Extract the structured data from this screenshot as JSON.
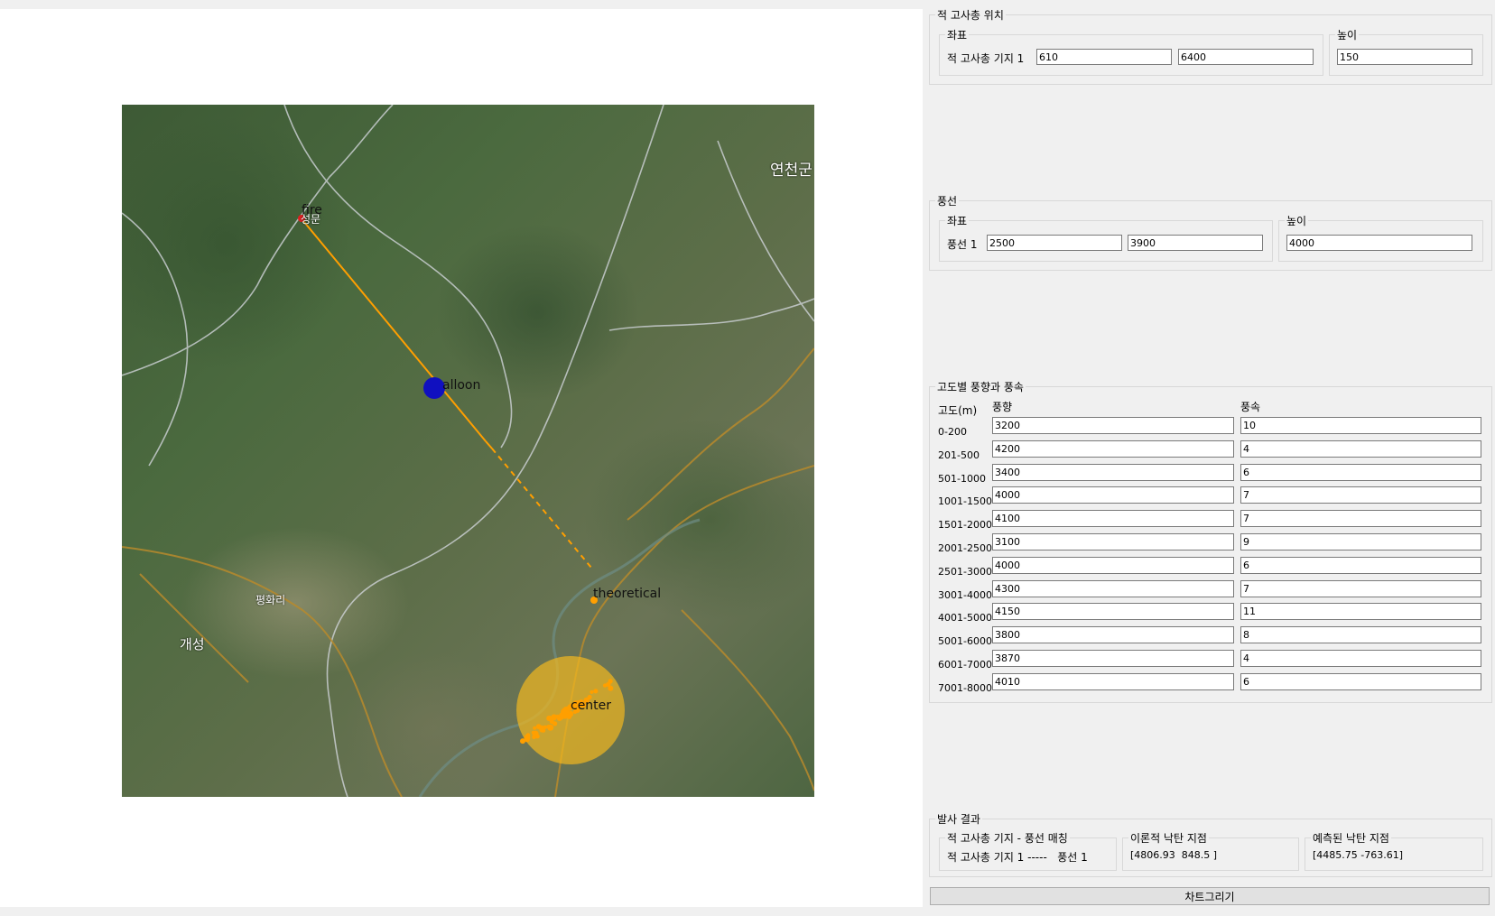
{
  "plot": {
    "labels": {
      "fire": "fire",
      "balloon": "alloon",
      "theoretical": "theoretical",
      "center": "center"
    },
    "places": {
      "yeoncheon": "연천군",
      "gaeseong": "개성",
      "pyeonghwa": "평화리",
      "near_fire": "성문"
    },
    "colors": {
      "trajectory": "#ff9f00",
      "balloon": "#1010c0",
      "fire": "#e02020",
      "impact_zone": "#f2b820",
      "scatter": "#ff9f00"
    }
  },
  "enemy_position": {
    "legend": "적 고사총 위치",
    "coords_legend": "좌표",
    "height_legend": "높이",
    "base_label": "적 고사총 기지 1",
    "x": "610",
    "y": "6400",
    "height": "150"
  },
  "balloon": {
    "legend": "풍선",
    "coords_legend": "좌표",
    "height_legend": "높이",
    "label": "풍선 1",
    "x": "2500",
    "y": "3900",
    "height": "4000"
  },
  "wind": {
    "legend": "고도별 풍향과 풍속",
    "col_altitude": "고도(m)",
    "col_direction": "풍향",
    "col_speed": "풍속",
    "rows": [
      {
        "altitude": "0-200",
        "direction": "3200",
        "speed": "10"
      },
      {
        "altitude": "201-500",
        "direction": "4200",
        "speed": "4"
      },
      {
        "altitude": "501-1000",
        "direction": "3400",
        "speed": "6"
      },
      {
        "altitude": "1001-1500",
        "direction": "4000",
        "speed": "7"
      },
      {
        "altitude": "1501-2000",
        "direction": "4100",
        "speed": "7"
      },
      {
        "altitude": "2001-2500",
        "direction": "3100",
        "speed": "9"
      },
      {
        "altitude": "2501-3000",
        "direction": "4000",
        "speed": "6"
      },
      {
        "altitude": "3001-4000",
        "direction": "4300",
        "speed": "7"
      },
      {
        "altitude": "4001-5000",
        "direction": "4150",
        "speed": "11"
      },
      {
        "altitude": "5001-6000",
        "direction": "3800",
        "speed": "8"
      },
      {
        "altitude": "6001-7000",
        "direction": "3870",
        "speed": "4"
      },
      {
        "altitude": "7001-8000",
        "direction": "4010",
        "speed": "6"
      }
    ]
  },
  "result": {
    "legend": "발사 결과",
    "match_legend": "적 고사총 기지 - 풍선 매칭",
    "match_value": "적 고사총 기지 1 -----   풍선 1",
    "theoretical_legend": "이론적 낙탄 지점",
    "theoretical_value": "[4806.93  848.5 ]",
    "predicted_legend": "예측된 낙탄 지점",
    "predicted_value": "[4485.75 -763.61]"
  },
  "draw_button_label": "차트그리기"
}
